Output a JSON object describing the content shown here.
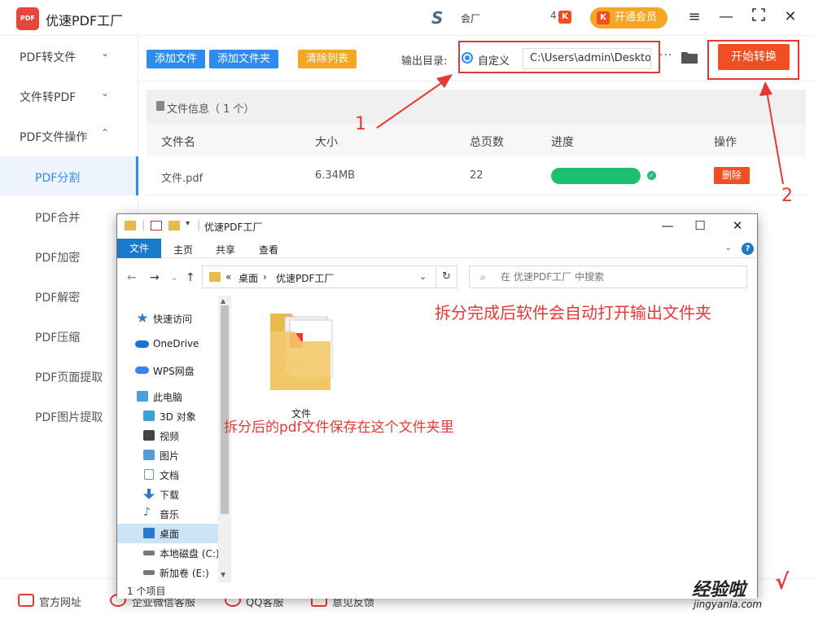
{
  "app": {
    "title": "优速PDF工厂",
    "logo_text": "PDF",
    "s_logo": "S",
    "s_text": "会厂",
    "k_text": "4",
    "k_badge": "K",
    "vip_label": "开通会员",
    "vip_icon": "K"
  },
  "colors": {
    "brand_red": "#f04e23",
    "accent_blue": "#2d8cf0",
    "orange": "#f5a623",
    "success_green": "#1dbf73",
    "annotation_red": "#e53935"
  },
  "sidebar": {
    "groups": [
      {
        "label": "PDF转文件",
        "chevron": "chevron-down-icon"
      },
      {
        "label": "文件转PDF",
        "chevron": "chevron-down-icon"
      },
      {
        "label": "PDF文件操作",
        "chevron": "chevron-up-icon"
      }
    ],
    "items": [
      {
        "label": "PDF分割",
        "active": true
      },
      {
        "label": "PDF合并"
      },
      {
        "label": "PDF加密"
      },
      {
        "label": "PDF解密"
      },
      {
        "label": "PDF压缩"
      },
      {
        "label": "PDF页面提取"
      },
      {
        "label": "PDF图片提取"
      }
    ]
  },
  "toolbar": {
    "add_file": "添加文件",
    "add_folder": "添加文件夹",
    "clear_list": "清除列表",
    "output_label": "输出目录:",
    "custom_label": "自定义",
    "output_path": "C:\\Users\\admin\\Deskto",
    "more_label": "···",
    "start_label": "开始转换"
  },
  "table": {
    "info_label": "文件信息（ 1 个）",
    "headers": [
      "文件名",
      "大小",
      "总页数",
      "进度",
      "操作"
    ],
    "rows": [
      {
        "name": "文件.pdf",
        "size": "6.34MB",
        "pages": "22",
        "progress": 1.0,
        "action": "删除"
      }
    ]
  },
  "explorer": {
    "title": "优速PDF工厂",
    "tabs": [
      "文件",
      "主页",
      "共享",
      "查看"
    ],
    "breadcrumb": [
      "«",
      "桌面",
      "›",
      "优速PDF工厂"
    ],
    "search_placeholder": "在 优速PDF工厂 中搜索",
    "nav_items": [
      {
        "label": "快速访问",
        "icon": "star-icon"
      },
      {
        "label": "OneDrive",
        "icon": "cloud-icon"
      },
      {
        "label": "WPS网盘",
        "icon": "cloud-icon"
      },
      {
        "label": "此电脑",
        "icon": "computer-icon"
      },
      {
        "label": "3D 对象",
        "icon": "cube-icon"
      },
      {
        "label": "视频",
        "icon": "video-icon"
      },
      {
        "label": "图片",
        "icon": "picture-icon"
      },
      {
        "label": "文档",
        "icon": "document-icon"
      },
      {
        "label": "下载",
        "icon": "download-icon"
      },
      {
        "label": "音乐",
        "icon": "music-icon"
      },
      {
        "label": "桌面",
        "icon": "desktop-icon",
        "selected": true
      },
      {
        "label": "本地磁盘 (C:)",
        "icon": "drive-icon"
      },
      {
        "label": "新加卷 (E:)",
        "icon": "drive-icon"
      }
    ],
    "folder_label": "文件",
    "status": "1 个项目"
  },
  "annotations": {
    "num1": "1",
    "num2": "2",
    "text_top": "拆分完成后软件会自动打开输出文件夹",
    "text_mid": "拆分后的pdf文件保存在这个文件夹里"
  },
  "bottom": {
    "items": [
      "官方网址",
      "企业微信客服",
      "QQ客服",
      "意见反馈"
    ],
    "watermark": "经验啦",
    "watermark_sub": "jingyanla.com",
    "watermark_check": "√"
  }
}
